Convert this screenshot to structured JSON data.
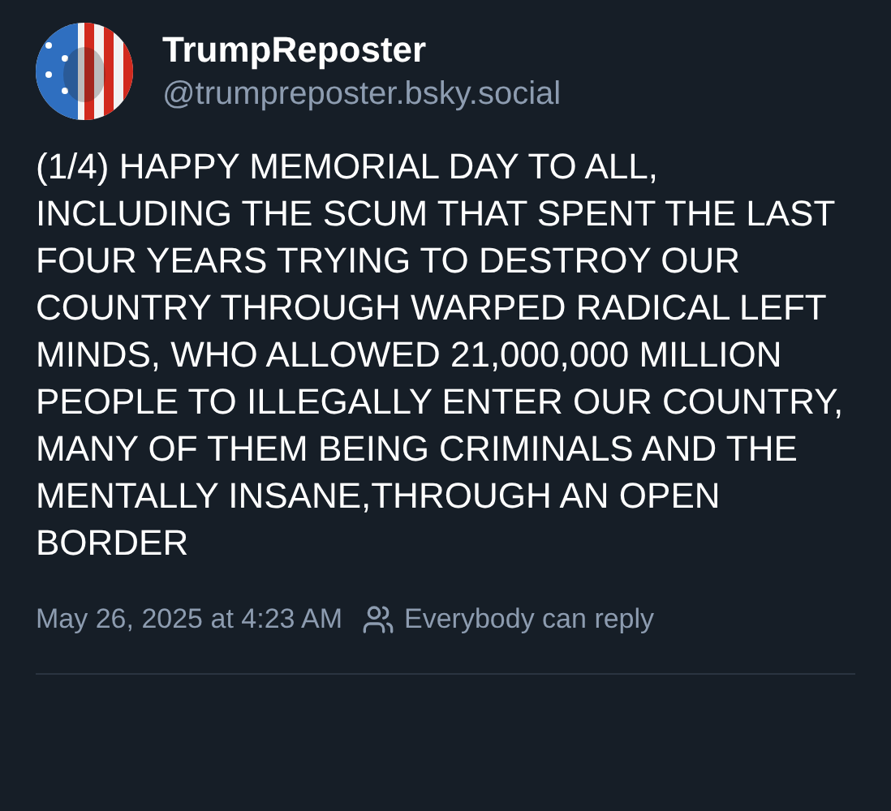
{
  "author": {
    "display_name": "TrumpReposter",
    "handle": "@trumpreposter.bsky.social"
  },
  "post": {
    "text": "(1/4) HAPPY MEMORIAL DAY TO ALL, INCLUDING THE SCUM THAT SPENT THE LAST FOUR YEARS TRYING TO DESTROY OUR COUNTRY THROUGH WARPED RADICAL LEFT MINDS, WHO ALLOWED 21,000,000 MILLION PEOPLE TO ILLEGALLY ENTER OUR COUNTRY, MANY OF THEM BEING CRIMINALS AND THE MENTALLY INSANE,THROUGH AN OPEN BORDER"
  },
  "footer": {
    "timestamp": "May 26, 2025 at 4:23 AM",
    "reply_setting": "Everybody can reply"
  }
}
